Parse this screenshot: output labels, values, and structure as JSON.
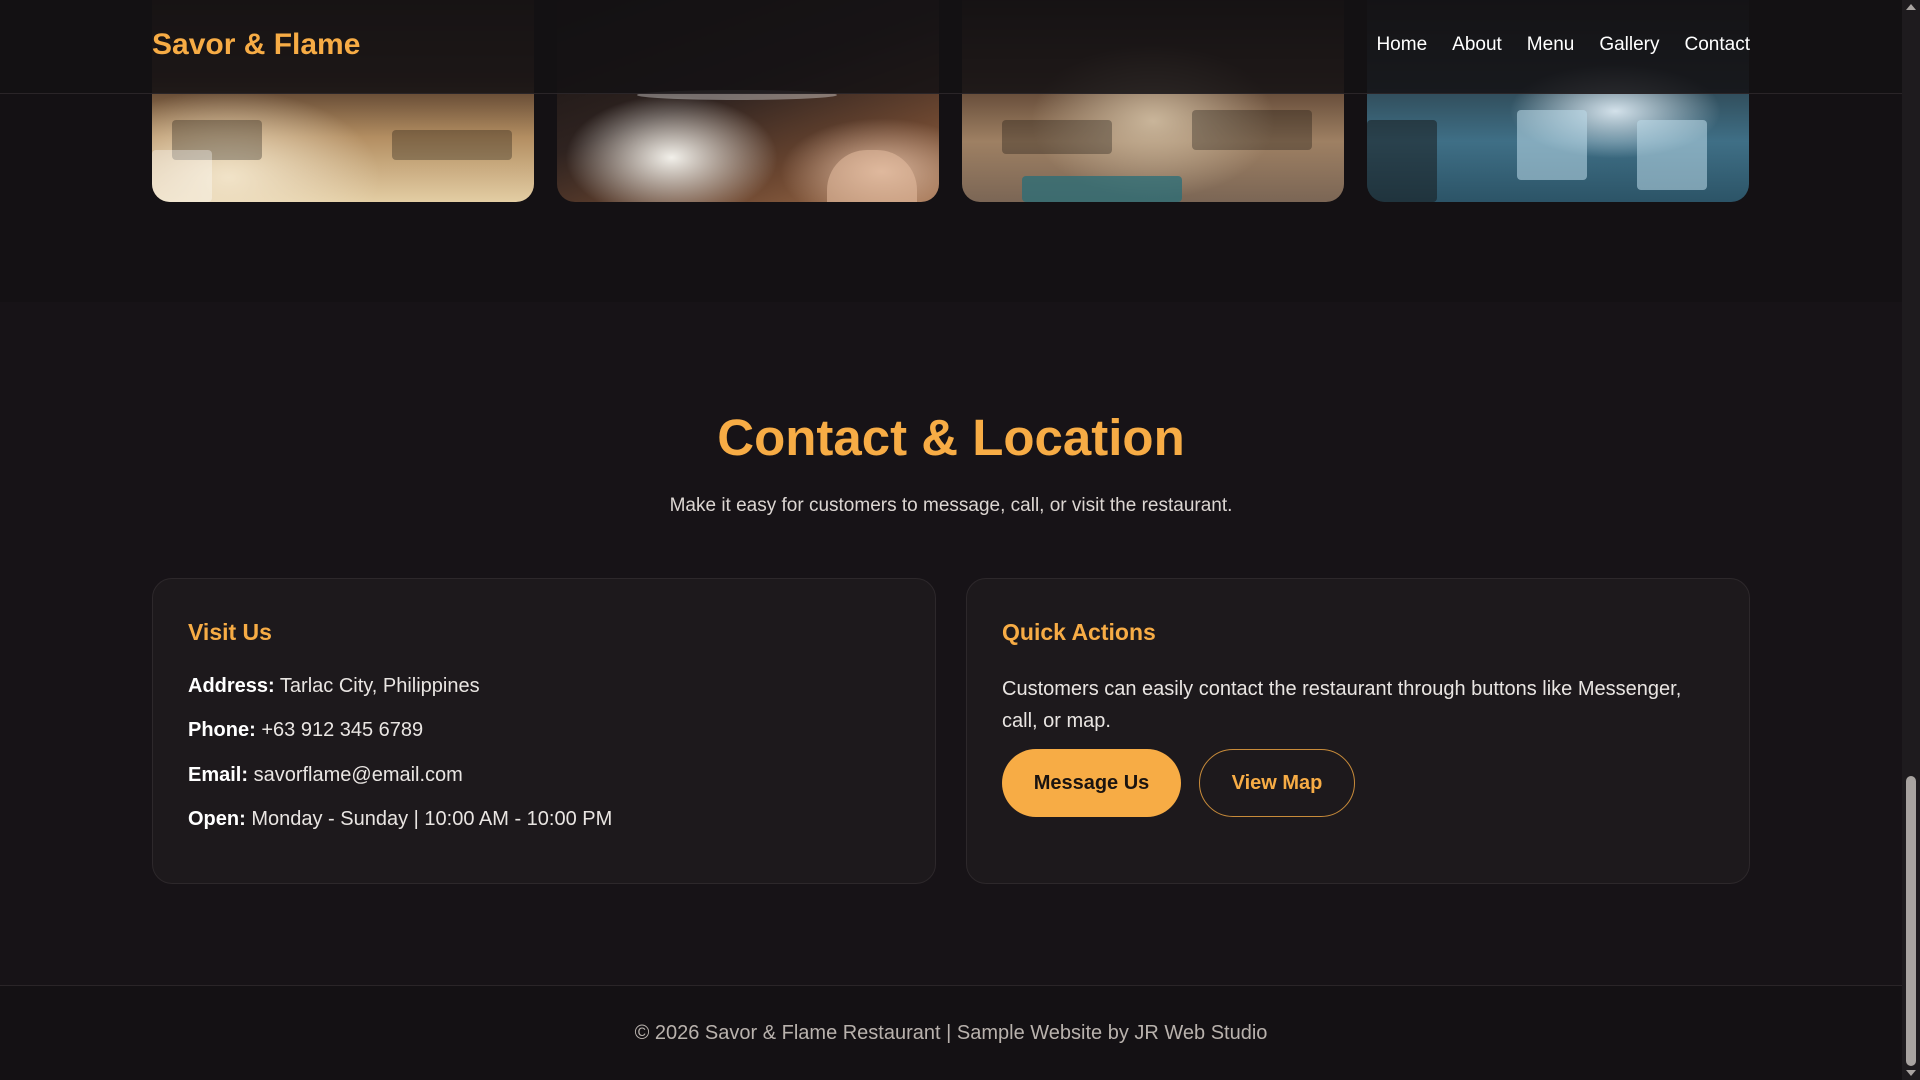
{
  "header": {
    "brand": "Savor & Flame",
    "nav": [
      "Home",
      "About",
      "Menu",
      "Gallery",
      "Contact"
    ]
  },
  "gallery": {
    "photos": [
      "restaurant-interior-photo",
      "dining-table-photo",
      "cafe-seating-photo",
      "blue-terrace-photo"
    ]
  },
  "contact": {
    "title": "Contact & Location",
    "subtitle": "Make it easy for customers to message, call, or visit the restaurant.",
    "visit": {
      "title": "Visit Us",
      "address_label": "Address:",
      "address_value": "Tarlac City, Philippines",
      "phone_label": "Phone:",
      "phone_value": "+63 912 345 6789",
      "email_label": "Email:",
      "email_value": "savorflame@email.com",
      "open_label": "Open:",
      "open_value": "Monday - Sunday | 10:00 AM - 10:00 PM"
    },
    "actions": {
      "title": "Quick Actions",
      "text": "Customers can easily contact the restaurant through buttons like Messenger, call, or map.",
      "message_button": "Message Us",
      "map_button": "View Map"
    }
  },
  "footer": {
    "text": "© 2026 Savor & Flame Restaurant | Sample Website by JR Web Studio"
  },
  "colors": {
    "accent": "#f7ac45",
    "background": "#141114",
    "card": "#1d191c"
  }
}
